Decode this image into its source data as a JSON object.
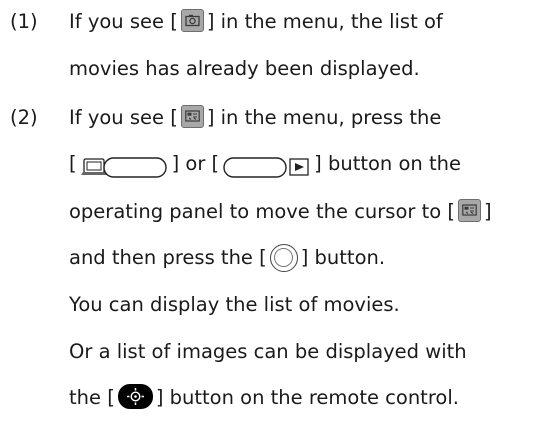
{
  "items": [
    {
      "number": "(1)",
      "lines": [
        {
          "before": "If you see [",
          "after": "] in the menu, the list of"
        },
        {
          "text": "movies has already been displayed."
        }
      ]
    },
    {
      "number": "(2)",
      "lines": [
        {
          "before": "If you see [",
          "after": "] in the menu, press the"
        },
        {
          "pre": "[",
          "mid": "] or [",
          "post": "] button on the"
        },
        {
          "before": "operating panel to move the cursor to [",
          "after": "]"
        },
        {
          "before": "and then press the [",
          "after": "] button."
        },
        {
          "text": "You can display the list of movies."
        },
        {
          "text": "Or a list of images can be displayed with"
        },
        {
          "before": "the [",
          "after": "] button on the remote control."
        }
      ]
    }
  ],
  "icons": {
    "still_mode": "camera-mode-icon",
    "movie_mode": "movie-mode-icon",
    "left_button": "left-arrow-button-icon",
    "right_button": "right-arrow-button-icon",
    "enter_button": "enter-button-icon",
    "remote_button": "remote-image-list-button-icon"
  },
  "colors": {
    "text": "#1a1a1a",
    "icon_grey": "#a8a8a8",
    "remote_button": "#000000"
  }
}
